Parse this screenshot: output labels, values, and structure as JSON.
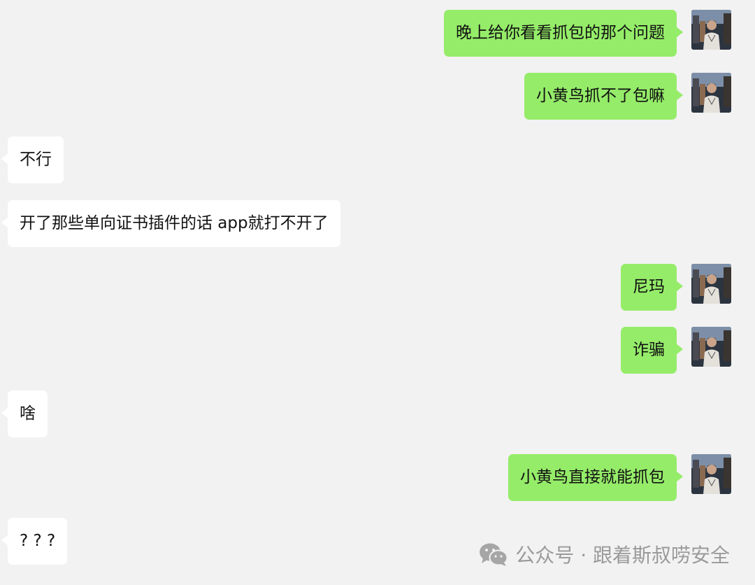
{
  "conversation": {
    "messages": [
      {
        "side": "sent",
        "text": "晚上给你看看抓包的那个问题"
      },
      {
        "side": "sent",
        "text": "小黄鸟抓不了包嘛"
      },
      {
        "side": "recv",
        "text": "不行"
      },
      {
        "side": "recv",
        "text": "开了那些单向证书插件的话 app就打不开了"
      },
      {
        "side": "sent",
        "text": "尼玛"
      },
      {
        "side": "sent",
        "text": "诈骗"
      },
      {
        "side": "recv",
        "text": "啥"
      },
      {
        "side": "sent",
        "text": "小黄鸟直接就能抓包"
      },
      {
        "side": "recv",
        "text": "? ? ?"
      }
    ]
  },
  "watermark": {
    "icon": "wechat-icon",
    "text": "公众号 · 跟着斯叔唠安全"
  },
  "colors": {
    "background": "#f2f2f2",
    "sent_bubble": "#95ec69",
    "received_bubble": "#ffffff",
    "watermark": "#9a9a9a"
  }
}
